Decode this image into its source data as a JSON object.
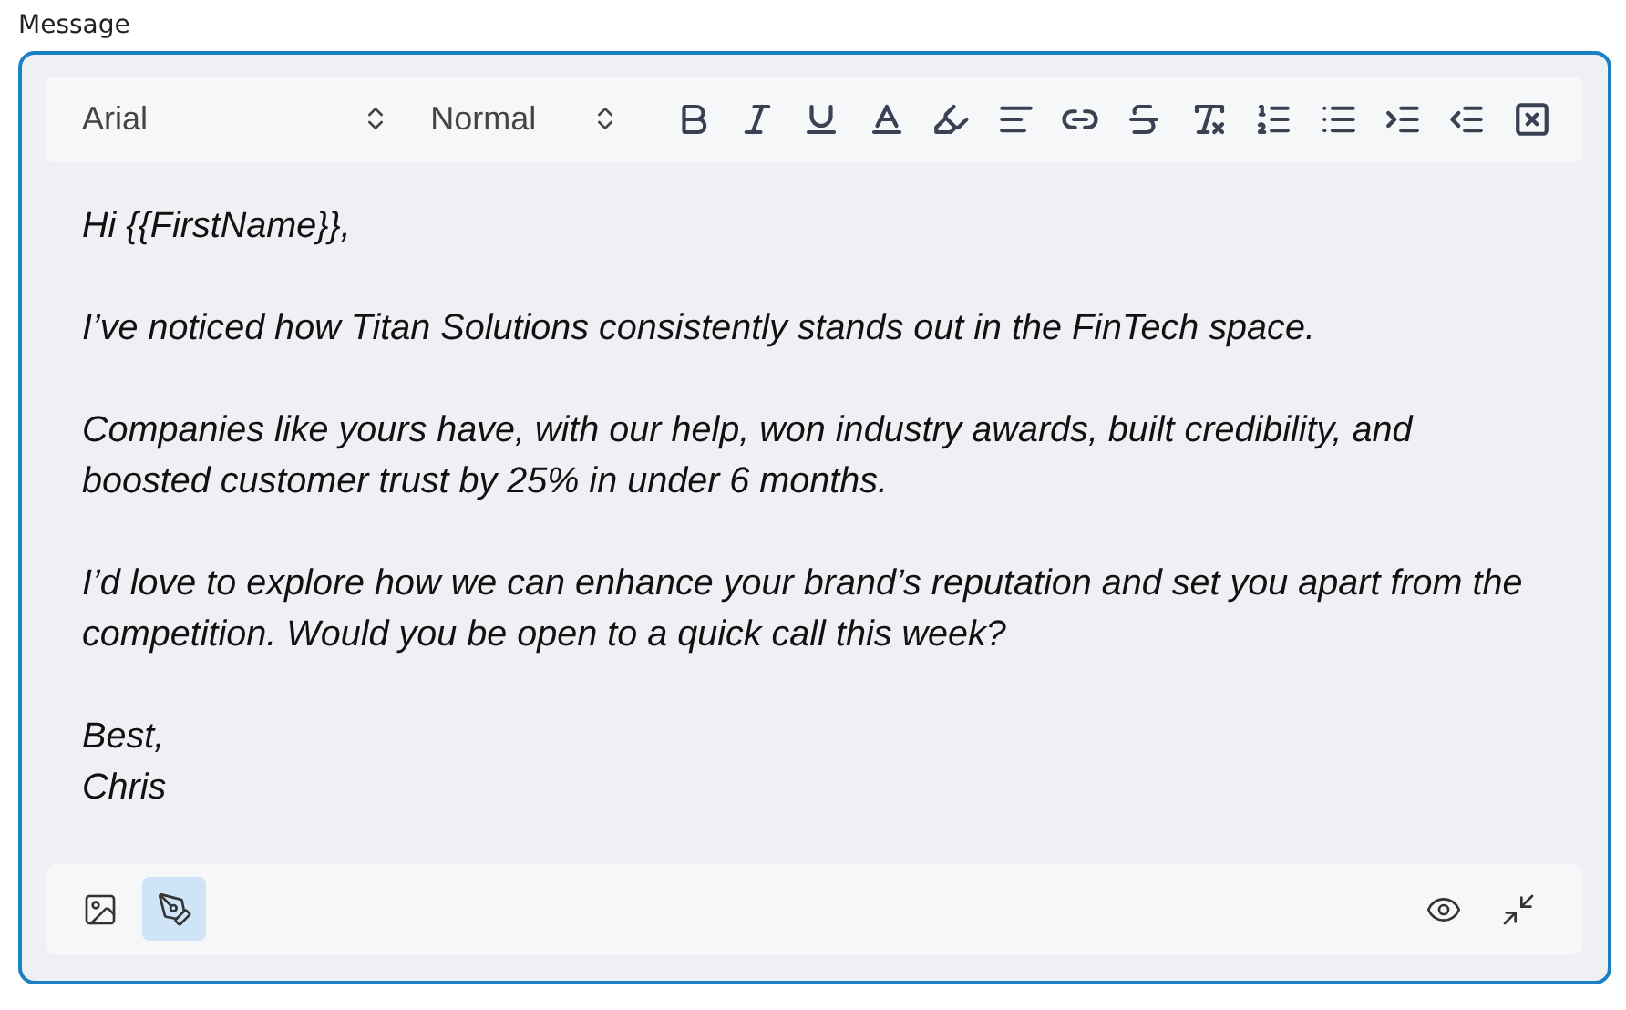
{
  "label": "Message",
  "toolbar": {
    "font": "Arial",
    "size": "Normal"
  },
  "body": [
    "Hi {{FirstName}},",
    "I’ve noticed how Titan Solutions consistently stands out in the FinTech space.",
    "Companies like yours have, with our help, won industry awards, built credibility, and boosted customer trust by 25% in under 6 months.",
    "I’d love to explore how we can enhance your brand’s reputation and set you apart from the competition. Would you be open to a quick call this week?",
    "Best,\nChris"
  ],
  "footer": {
    "image_button": {
      "selected": false
    },
    "pen_button": {
      "selected": true
    }
  }
}
